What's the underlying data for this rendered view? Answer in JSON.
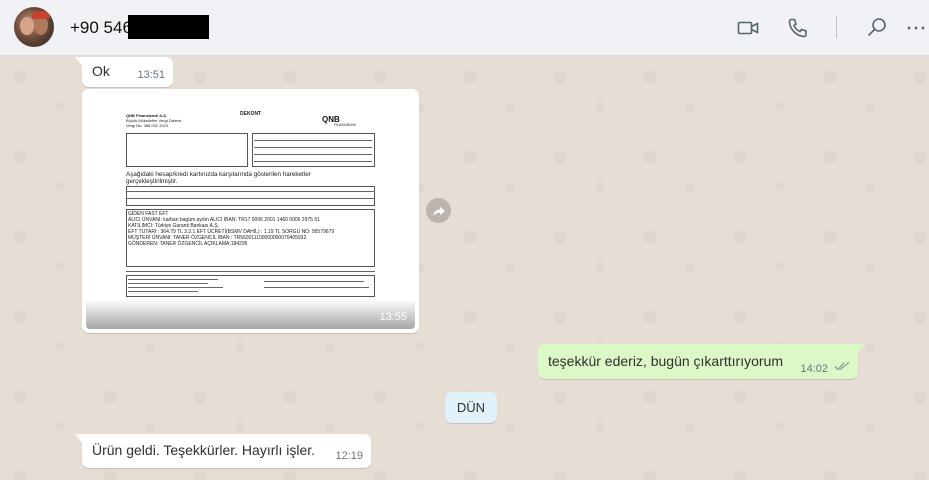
{
  "header": {
    "contact_name": "+90 546",
    "icons": [
      "video-camera-icon",
      "phone-icon",
      "search-icon",
      "more-icon"
    ]
  },
  "messages": [
    {
      "direction": "incoming",
      "text": "Ok",
      "time": "13:51"
    },
    {
      "direction": "incoming",
      "type": "image",
      "time": "13:55",
      "document": {
        "company": "QNB Finansbank A.Ş.",
        "tax_office": "Büyük Mükellefler Vergi Dairesi",
        "tax_no": "Vergi No: 388 002 3324",
        "title": "DEKONT",
        "brand": "QNB",
        "brand_sub": "FINANSBANK",
        "heading": "Aşağıdaki hesap/kredi kartınızda karşılarında gösterilen hareketler gerçekleştirilmiştir.",
        "lines": [
          "GİDEN FAST EFT",
          "ALICI ÜNVANI: karban bagüm aydın   ALICI IBAN: TR17 0006 2001 1460 0006 2975 51",
          "KATILIMCI: Türkiye Garanti Bankası A.Ş.",
          "EFT TUTARI : 364.79 TL 3.3.1 EFT ÜCRETİ(BSMV DAHİL) : 1.19 TL SORGU NO: 95579679",
          "MÜŞTERİ ÜNVANI: TANER ÖZGENCİL IBAN : TR560011100000000070405932",
          "GÖNDEREN: TANER ÖZGENCİL   AÇIKLAMA:184295"
        ]
      }
    },
    {
      "direction": "outgoing",
      "text": "teşekkür ederiz, bugün çıkarttırıyorum",
      "time": "14:02"
    },
    {
      "direction": "system",
      "text": "DÜN"
    },
    {
      "direction": "incoming",
      "text": "Ürün geldi. Teşekkürler. Hayırlı işler.",
      "time": "12:19"
    }
  ],
  "colors": {
    "header_bg": "#f0f2f5",
    "chat_bg": "#e6ddd4",
    "incoming_bubble": "#ffffff",
    "outgoing_bubble": "#dcf8c6",
    "day_chip": "#e1f2fb",
    "read_ticks": "#8a9aa3"
  }
}
